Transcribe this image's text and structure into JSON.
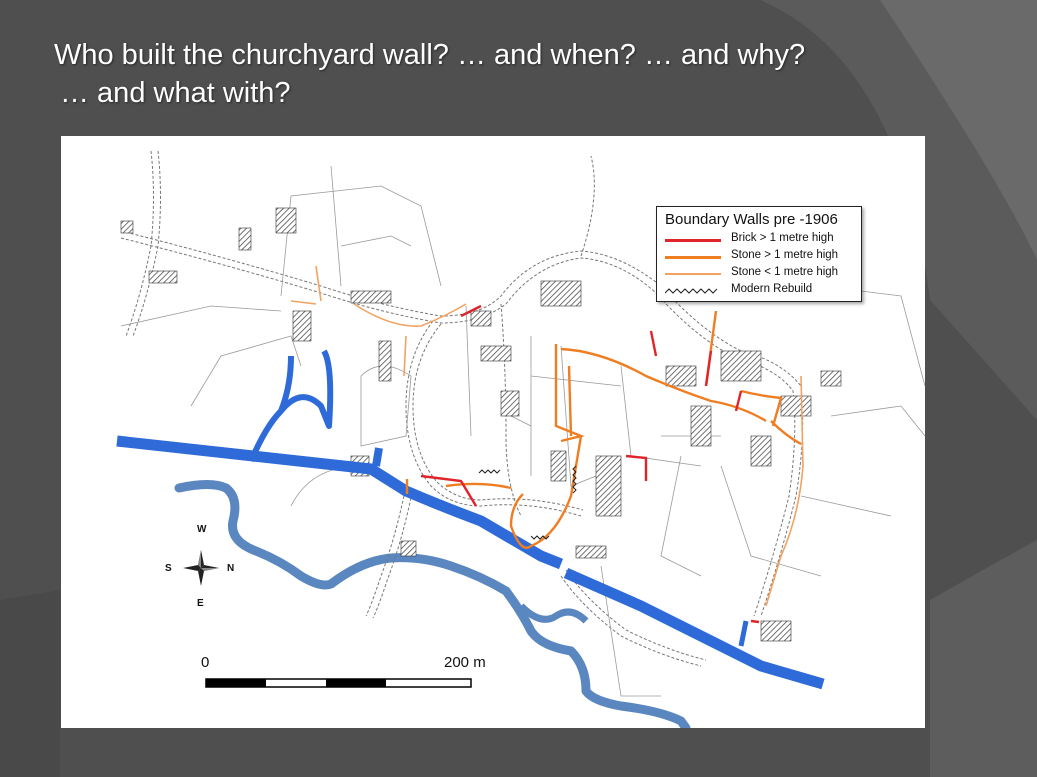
{
  "slide": {
    "title_line1": "Who built the churchyard wall? … and when? … and why?",
    "title_line2": "… and what with?"
  },
  "map": {
    "legend": {
      "title": "Boundary Walls pre -1906",
      "items": [
        {
          "label": "Brick > 1 metre high",
          "color": "#e0242b",
          "style": "solid-thick"
        },
        {
          "label": "Stone > 1 metre high",
          "color": "#ef7d22",
          "style": "solid-thick"
        },
        {
          "label": "Stone < 1 metre high",
          "color": "#f2a361",
          "style": "solid-thin"
        },
        {
          "label": "Modern Rebuild",
          "color": "#222222",
          "style": "zigzag"
        }
      ]
    },
    "compass": {
      "top": "W",
      "left": "S",
      "right": "N",
      "bottom": "E"
    },
    "scale": {
      "start_label": "0",
      "end_label": "200 m"
    },
    "colors": {
      "canal": "#2f6bd8",
      "river": "#5a87bf",
      "brick": "#e0242b",
      "stone_high": "#ef7d22",
      "stone_low": "#f2a361",
      "background": "#555555"
    }
  }
}
